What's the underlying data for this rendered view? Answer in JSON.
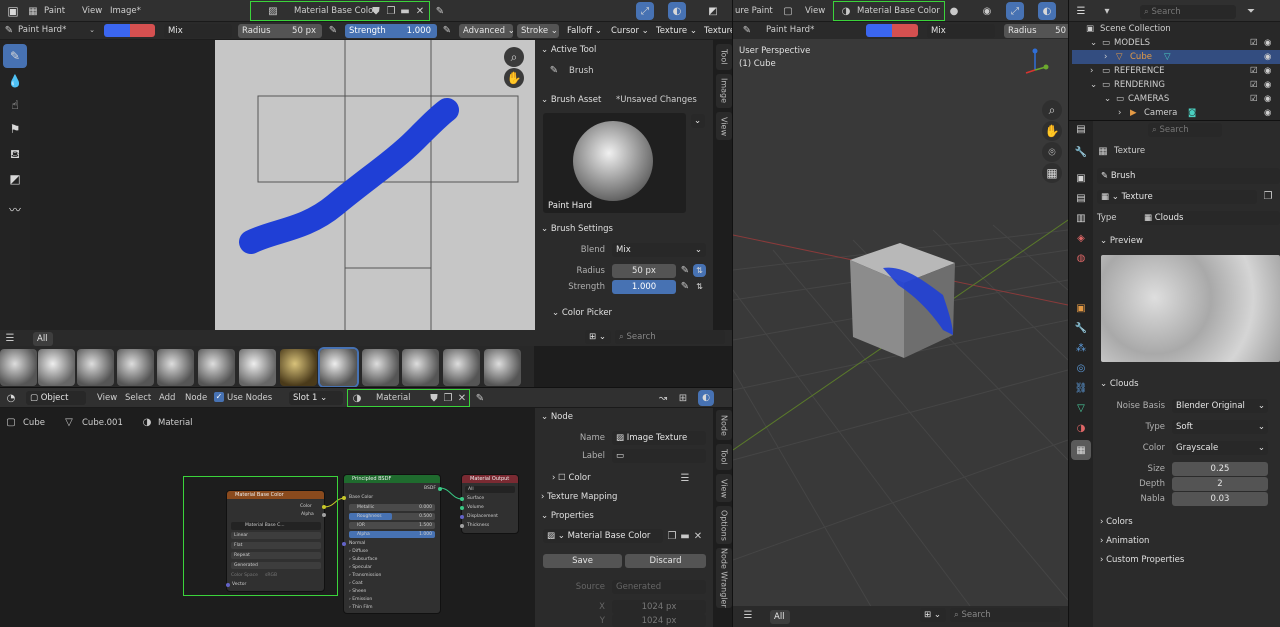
{
  "image_editor": {
    "menu": [
      "Paint",
      "View",
      "Image*"
    ],
    "image_name": "Material Base Color",
    "brush_name": "Paint Hard*",
    "blend": "Mix",
    "radius_label": "Radius",
    "radius_value": "50 px",
    "strength_label": "Strength",
    "strength_value": "1.000",
    "header_menus": [
      "Advanced",
      "Stroke",
      "Falloff",
      "Cursor",
      "Texture",
      "Texture"
    ],
    "asset_shelf_tab": "All",
    "side_tabs": [
      "Tool",
      "Image",
      "View"
    ]
  },
  "tool_panel": {
    "active_tool_header": "Active Tool",
    "active_tool": "Brush",
    "brush_asset_header": "Brush Asset",
    "unsaved": "*Unsaved Changes",
    "brush_preview_name": "Paint Hard",
    "brush_settings_header": "Brush Settings",
    "blend_label": "Blend",
    "blend_value": "Mix",
    "radius_label": "Radius",
    "radius_value": "50 px",
    "strength_label": "Strength",
    "strength_value": "1.000",
    "color_picker": "Color Picker",
    "search_placeholder": "Search"
  },
  "viewport": {
    "menu_prefix": "ure Paint",
    "view": "View",
    "image_name": "Material Base Color",
    "brush_name": "Paint Hard*",
    "blend": "Mix",
    "radius_label": "Radius",
    "radius_value_partial": "50",
    "perspective": "User Perspective",
    "object": "(1) Cube",
    "shelf_tab": "All",
    "search_placeholder": "Search"
  },
  "node_editor": {
    "mode": "Object",
    "menu": [
      "View",
      "Select",
      "Add",
      "Node"
    ],
    "use_nodes": "Use Nodes",
    "slot": "Slot 1",
    "material": "Material",
    "breadcrumb": [
      "Cube",
      "Cube.001",
      "Material"
    ],
    "texture_node": {
      "title": "Material Base Color",
      "outputs": [
        "Color",
        "Alpha"
      ],
      "image": "Material Base C...",
      "interpolation": "Linear",
      "projection": "Flat",
      "extension": "Repeat",
      "source": "Generated",
      "color_space_label": "Color Space",
      "color_space": "sRGB",
      "vector": "Vector"
    },
    "bsdf_node": {
      "title": "Principled BSDF",
      "output": "BSDF",
      "base_color": "Base Color",
      "fields": [
        {
          "label": "Metallic",
          "value": "0.000"
        },
        {
          "label": "Roughness",
          "value": "0.500"
        },
        {
          "label": "IOR",
          "value": "1.500"
        },
        {
          "label": "Alpha",
          "value": "1.000"
        }
      ],
      "normal": "Normal",
      "subpanels": [
        "Diffuse",
        "Subsurface",
        "Specular",
        "Transmission",
        "Coat",
        "Sheen",
        "Emission",
        "Thin Film"
      ]
    },
    "output_node": {
      "title": "Material Output",
      "target": "All",
      "inputs": [
        "Surface",
        "Volume",
        "Displacement",
        "Thickness"
      ]
    },
    "side_tabs": [
      "Node",
      "Tool",
      "View",
      "Options",
      "Node Wrangler"
    ]
  },
  "node_panel": {
    "node_header": "Node",
    "name_label": "Name",
    "name_value": "Image Texture",
    "label_label": "Label",
    "color_label": "Color",
    "texture_mapping": "Texture Mapping",
    "properties_header": "Properties",
    "image_name": "Material Base Color",
    "save": "Save",
    "discard": "Discard",
    "source_label": "Source",
    "source_value": "Generated",
    "x_label": "X",
    "x_value": "1024 px",
    "y_label": "Y",
    "y_value": "1024 px"
  },
  "outliner": {
    "search_placeholder": "Search",
    "rows": [
      "Scene Collection",
      "MODELS",
      "Cube",
      "REFERENCE",
      "RENDERING",
      "CAMERAS",
      "Camera"
    ]
  },
  "properties": {
    "search_placeholder": "Search",
    "context": "Texture",
    "brush": "Brush",
    "texture_name": "Texture",
    "type_label": "Type",
    "type_value": "Clouds",
    "preview_header": "Preview",
    "clouds_header": "Clouds",
    "noise_basis_label": "Noise Basis",
    "noise_basis_value": "Blender Original",
    "noise_type_label": "Type",
    "noise_type_value": "Soft",
    "color_label": "Color",
    "color_value": "Grayscale",
    "size_label": "Size",
    "size_value": "0.25",
    "depth_label": "Depth",
    "depth_value": "2",
    "nabla_label": "Nabla",
    "nabla_value": "0.03",
    "collapsed": [
      "Colors",
      "Animation",
      "Custom Properties"
    ]
  },
  "colors": {
    "primary_swatch": "#3b66f0",
    "secondary_swatch": "#d55050",
    "stroke": "#1f3fd6",
    "selection_outline": "#3bd33b",
    "accent": "#4772b3"
  }
}
